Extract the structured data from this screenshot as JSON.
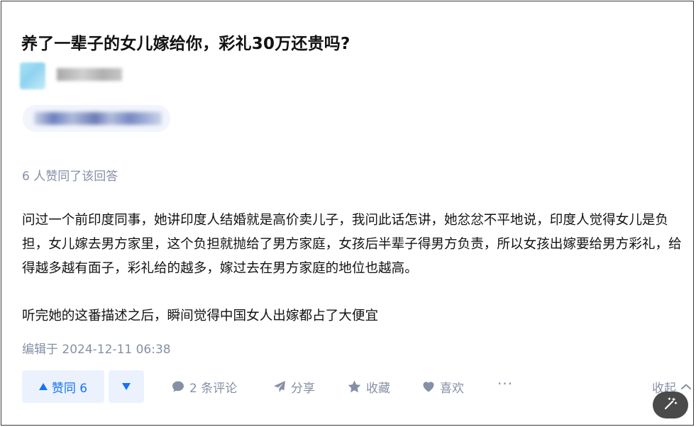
{
  "question": {
    "title": "养了一辈子的女儿嫁给你，彩礼30万还贵吗?"
  },
  "answer": {
    "upvote_summary": "6 人赞同了该回答",
    "paragraphs": [
      "问过一个前印度同事，她讲印度人结婚就是高价卖儿子，我问此话怎讲，她忿忿不平地说，印度人觉得女儿是负担，女儿嫁去男方家里，这个负担就抛给了男方家庭，女孩后半辈子得男方负责，所以女孩出嫁要给男方彩礼，给得越多越有面子，彩礼给的越多，嫁过去在男方家庭的地位也越高。",
      "听完她的这番描述之后，瞬间觉得中国女人出嫁都占了大便宜"
    ],
    "edit_time": "编辑于 2024-12-11 06:38"
  },
  "actions": {
    "upvote_label": "赞同 6",
    "comment_label": "2 条评论",
    "share_label": "分享",
    "collect_label": "收藏",
    "like_label": "喜欢",
    "more_label": "···",
    "collapse_label": "收起"
  },
  "icons": {
    "upvote": "triangle-up-icon",
    "downvote": "triangle-down-icon",
    "comment": "comment-bubble-icon",
    "share": "paper-plane-icon",
    "collect": "star-icon",
    "like": "heart-icon",
    "collapse": "chevron-up-icon",
    "floating": "magic-wand-icon"
  },
  "colors": {
    "accent": "#1772f6",
    "accent_bg": "#ebf2fe",
    "muted_text": "#8590a6",
    "body_text": "#121212"
  }
}
